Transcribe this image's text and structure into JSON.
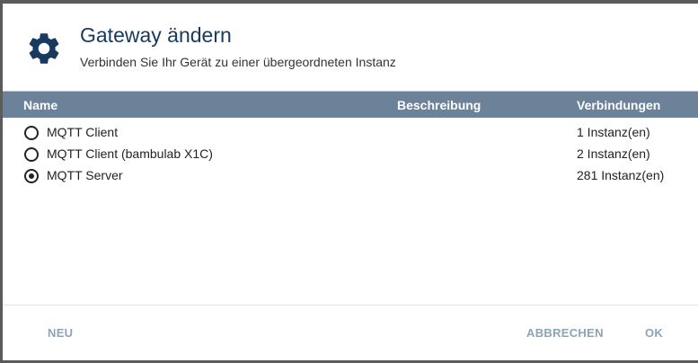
{
  "dialog": {
    "title": "Gateway ändern",
    "subtitle": "Verbinden Sie Ihr Gerät zu einer übergeordneten Instanz",
    "icon": "gear-icon"
  },
  "table": {
    "columns": [
      "Name",
      "Beschreibung",
      "Verbindungen"
    ],
    "rows": [
      {
        "name": "MQTT Client",
        "description": "",
        "connections": "1 Instanz(en)",
        "selected": false
      },
      {
        "name": "MQTT Client (bambulab X1C)",
        "description": "",
        "connections": "2 Instanz(en)",
        "selected": false
      },
      {
        "name": "MQTT Server",
        "description": "",
        "connections": "281 Instanz(en)",
        "selected": true
      }
    ]
  },
  "footer": {
    "new_label": "NEU",
    "cancel_label": "ABBRECHEN",
    "ok_label": "OK"
  },
  "colors": {
    "header_bg": "#6b8299",
    "title": "#173a5e",
    "button_text": "#8fa3b6"
  }
}
